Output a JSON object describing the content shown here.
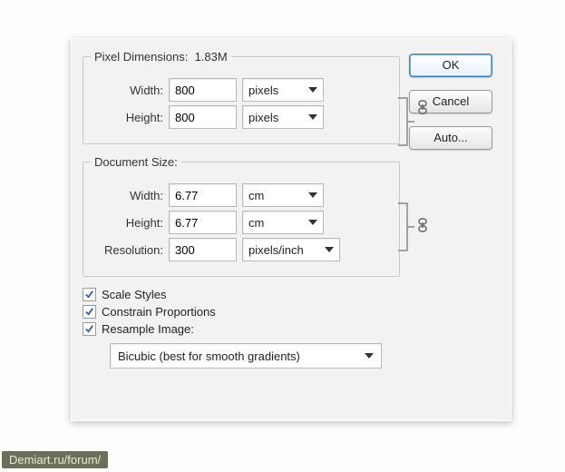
{
  "pixel_dimensions": {
    "legend": "Pixel Dimensions:",
    "size": "1.83M",
    "width_label": "Width:",
    "width_value": "800",
    "width_unit": "pixels",
    "height_label": "Height:",
    "height_value": "800",
    "height_unit": "pixels"
  },
  "document_size": {
    "legend": "Document Size:",
    "width_label": "Width:",
    "width_value": "6.77",
    "width_unit": "cm",
    "height_label": "Height:",
    "height_value": "6.77",
    "height_unit": "cm",
    "resolution_label": "Resolution:",
    "resolution_value": "300",
    "resolution_unit": "pixels/inch"
  },
  "checkboxes": {
    "scale_styles": "Scale Styles",
    "constrain": "Constrain Proportions",
    "resample": "Resample Image:"
  },
  "resample_method": "Bicubic (best for smooth gradients)",
  "buttons": {
    "ok": "OK",
    "cancel": "Cancel",
    "auto": "Auto..."
  },
  "watermark": "Demiart.ru/forum/"
}
